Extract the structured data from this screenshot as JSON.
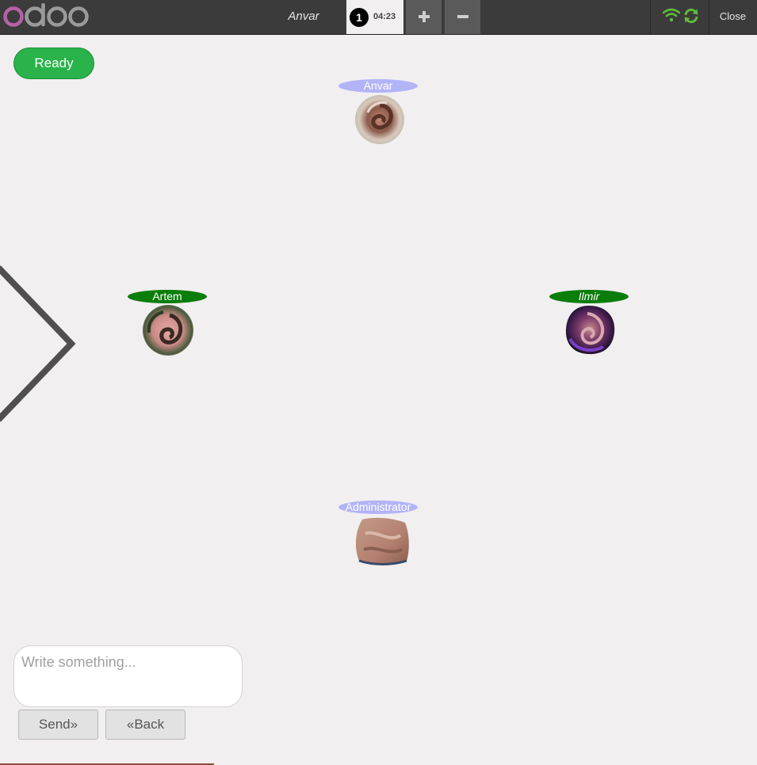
{
  "topbar": {
    "user_name": "Anvar",
    "order_number": "1",
    "order_time": "04:23",
    "close_label": "Close",
    "status_color": "#5fbb3a"
  },
  "ready_label": "Ready",
  "participants": [
    {
      "name": "Anvar",
      "label_color": "#b3b3f8"
    },
    {
      "name": "Artem",
      "label_color": "#0a7d0a"
    },
    {
      "name": "Ilmir",
      "label_color": "#0a7d0a"
    },
    {
      "name": "Administrator",
      "label_color": "#b3b3f8"
    }
  ],
  "chat": {
    "placeholder": "Write something...",
    "send_label": "Send",
    "back_label": "Back"
  },
  "icons": {
    "logo": "odoo-logo",
    "wifi": "wifi-icon",
    "sync": "sync-icon",
    "add": "plus-icon",
    "remove": "minus-icon",
    "prev": "chevron-left-arrow-icon"
  }
}
